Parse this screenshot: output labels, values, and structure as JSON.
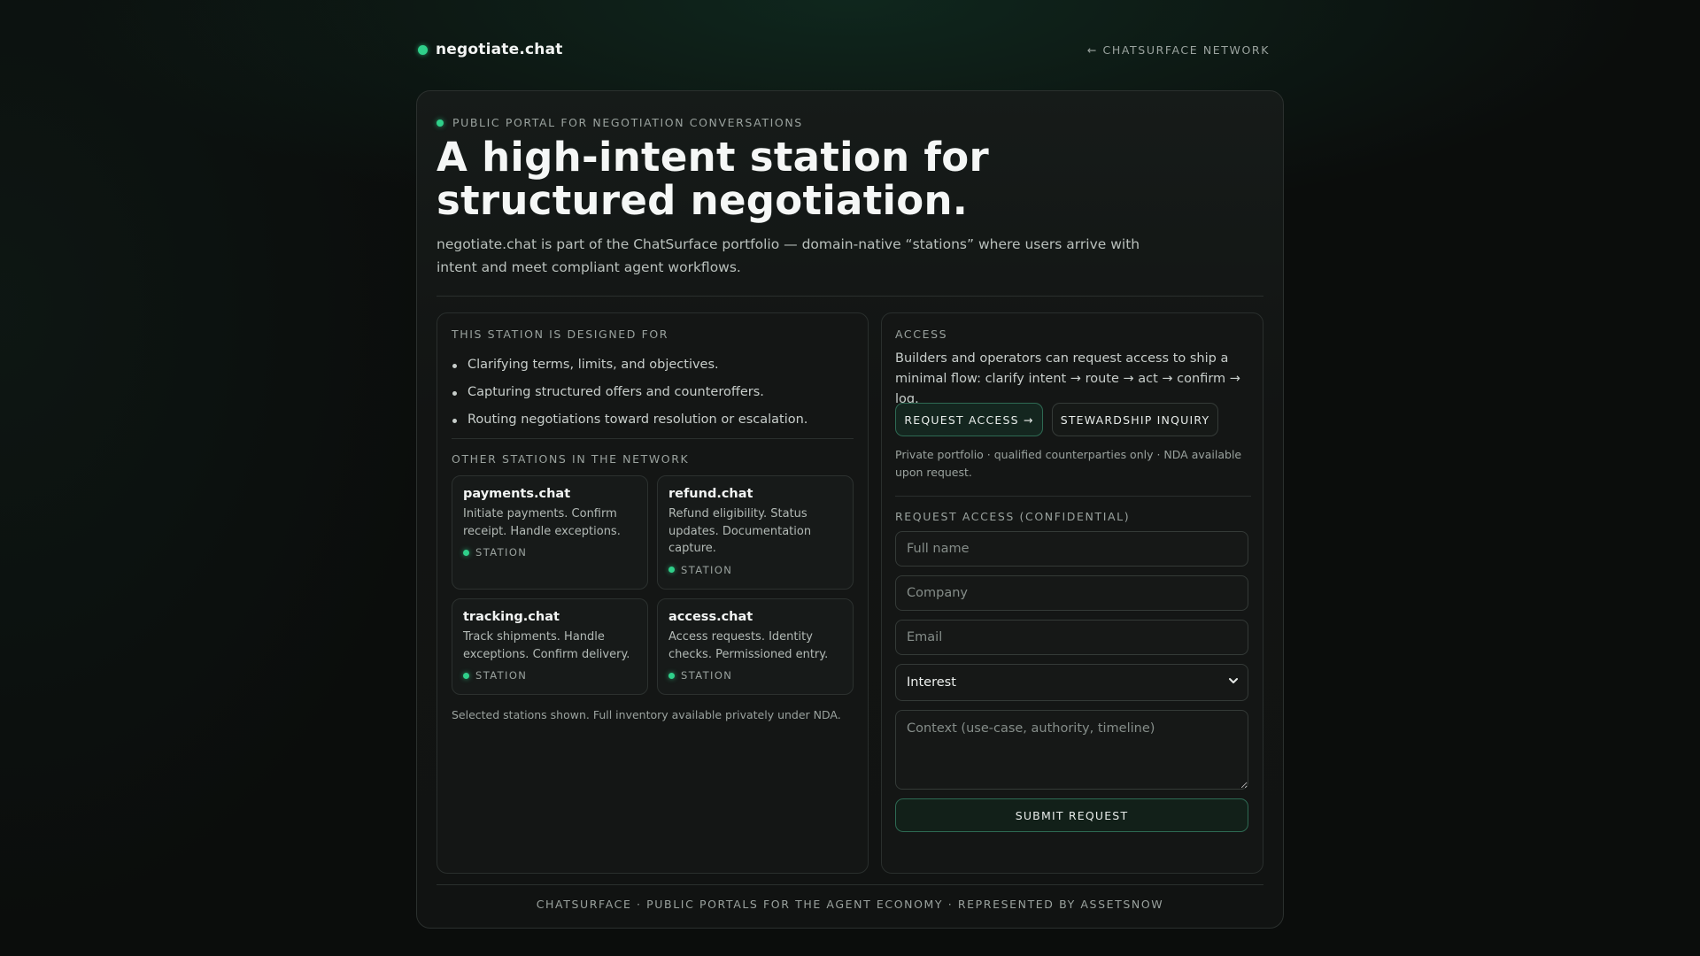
{
  "header": {
    "brand": "negotiate.chat",
    "network_link": "← CHATSURFACE NETWORK"
  },
  "hero": {
    "eyebrow": "PUBLIC PORTAL FOR NEGOTIATION CONVERSATIONS",
    "title": "A high-intent station for structured negotiation.",
    "description": "negotiate.chat is part of the ChatSurface portfolio — domain-native “stations” where users arrive with intent and meet compliant agent workflows."
  },
  "designed_for": {
    "label": "THIS STATION IS DESIGNED FOR",
    "items": [
      "Clarifying terms, limits, and objectives.",
      "Capturing structured offers and counteroffers.",
      "Routing negotiations toward resolution or escalation."
    ]
  },
  "other_stations": {
    "label": "OTHER STATIONS IN THE NETWORK",
    "stations": [
      {
        "name": "payments.chat",
        "description": "Initiate payments. Confirm receipt. Handle exceptions.",
        "badge": "STATION"
      },
      {
        "name": "refund.chat",
        "description": "Refund eligibility. Status updates. Documentation capture.",
        "badge": "STATION"
      },
      {
        "name": "tracking.chat",
        "description": "Track shipments. Handle exceptions. Confirm delivery.",
        "badge": "STATION"
      },
      {
        "name": "access.chat",
        "description": "Access requests. Identity checks. Permissioned entry.",
        "badge": "STATION"
      }
    ],
    "note": "Selected stations shown. Full inventory available privately under NDA."
  },
  "access": {
    "label": "ACCESS",
    "description": "Builders and operators can request access to ship a minimal flow: clarify intent → route → act → confirm → log.",
    "request_button": "REQUEST ACCESS →",
    "stewardship_button": "STEWARDSHIP INQUIRY",
    "private_note": "Private portfolio · qualified counterparties only · NDA available upon request."
  },
  "form": {
    "label": "REQUEST ACCESS (CONFIDENTIAL)",
    "name_placeholder": "Full name",
    "company_placeholder": "Company",
    "email_placeholder": "Email",
    "interest_selected": "Interest",
    "context_placeholder": "Context (use-case, authority, timeline)",
    "submit_label": "SUBMIT REQUEST"
  },
  "footer": {
    "text": "CHATSURFACE · PUBLIC PORTALS FOR THE AGENT ECONOMY · REPRESENTED BY ASSETSNOW"
  },
  "colors": {
    "accent": "#2fd08a",
    "background": "#0b0d0c",
    "card": "#121413",
    "button_border": "#2e6a53"
  },
  "icons": {
    "brand_dot": "status-dot-icon",
    "select_arrow": "chevron-down-icon"
  }
}
